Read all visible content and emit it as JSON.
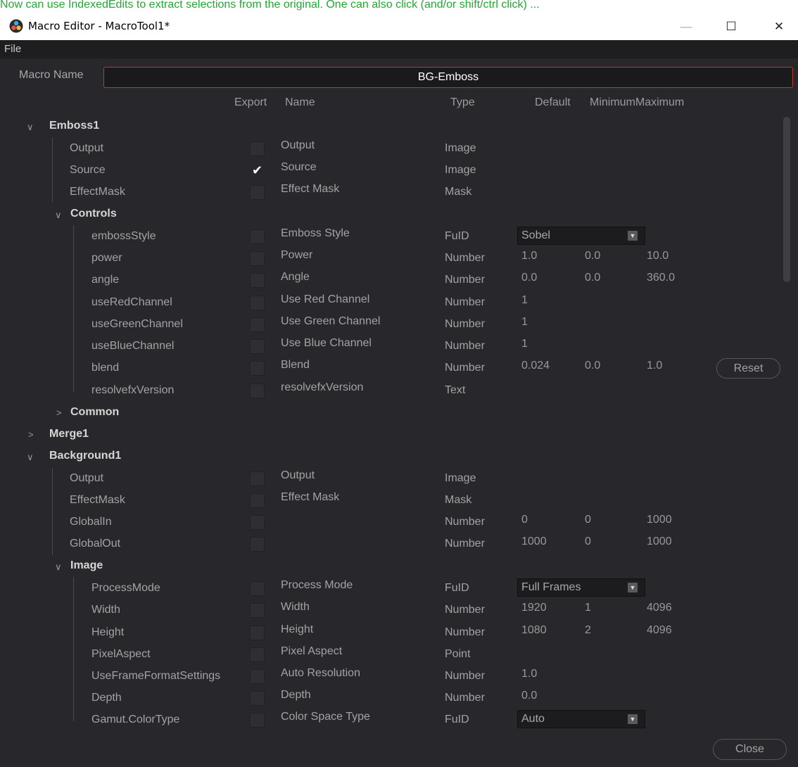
{
  "top_note": "Now can use IndexedEdits to extract selections from the original. One can also click (and/or shift/ctrl click) ...",
  "window": {
    "title": "Macro Editor - MacroTool1*",
    "minimize": "—",
    "maximize": "☐",
    "close": "✕"
  },
  "menu": {
    "file": "File"
  },
  "macro_name": {
    "label": "Macro Name",
    "value": "BG-Emboss"
  },
  "columns": {
    "export": "Export",
    "name": "Name",
    "type": "Type",
    "default": "Default",
    "minmax": "MinimumMaximum"
  },
  "groups": {
    "emboss1": "Emboss1",
    "controls": "Controls",
    "common": "Common",
    "merge1": "Merge1",
    "background1": "Background1",
    "image": "Image"
  },
  "emboss_io": [
    {
      "id": "Output",
      "name": "Output",
      "type": "Image",
      "checked": false
    },
    {
      "id": "Source",
      "name": "Source",
      "type": "Image",
      "checked": true
    },
    {
      "id": "EffectMask",
      "name": "Effect Mask",
      "type": "Mask",
      "checked": false
    }
  ],
  "controls": [
    {
      "id": "embossStyle",
      "name": "Emboss Style",
      "type": "FuID",
      "dropdown": "Sobel"
    },
    {
      "id": "power",
      "name": "Power",
      "type": "Number",
      "default": "1.0",
      "min": "0.0",
      "max": "10.0"
    },
    {
      "id": "angle",
      "name": "Angle",
      "type": "Number",
      "default": "0.0",
      "min": "0.0",
      "max": "360.0"
    },
    {
      "id": "useRedChannel",
      "name": "Use Red Channel",
      "type": "Number",
      "default": "1"
    },
    {
      "id": "useGreenChannel",
      "name": "Use Green Channel",
      "type": "Number",
      "default": "1"
    },
    {
      "id": "useBlueChannel",
      "name": "Use Blue Channel",
      "type": "Number",
      "default": "1"
    },
    {
      "id": "blend",
      "name": "Blend",
      "type": "Number",
      "default": "0.024",
      "min": "0.0",
      "max": "1.0"
    },
    {
      "id": "resolvefxVersion",
      "name": "resolvefxVersion",
      "type": "Text"
    }
  ],
  "reset_label": "Reset",
  "background_io": [
    {
      "id": "Output",
      "name": "Output",
      "type": "Image"
    },
    {
      "id": "EffectMask",
      "name": "Effect Mask",
      "type": "Mask"
    },
    {
      "id": "GlobalIn",
      "name": "",
      "type": "Number",
      "default": "0",
      "min": "0",
      "max": "1000"
    },
    {
      "id": "GlobalOut",
      "name": "",
      "type": "Number",
      "default": "1000",
      "min": "0",
      "max": "1000"
    }
  ],
  "image": [
    {
      "id": "ProcessMode",
      "name": "Process Mode",
      "type": "FuID",
      "dropdown": "Full Frames"
    },
    {
      "id": "Width",
      "name": "Width",
      "type": "Number",
      "default": "1920",
      "min": "1",
      "max": "4096"
    },
    {
      "id": "Height",
      "name": "Height",
      "type": "Number",
      "default": "1080",
      "min": "2",
      "max": "4096"
    },
    {
      "id": "PixelAspect",
      "name": "Pixel Aspect",
      "type": "Point"
    },
    {
      "id": "UseFrameFormatSettings",
      "name": "Auto Resolution",
      "type": "Number",
      "default": "1.0"
    },
    {
      "id": "Depth",
      "name": "Depth",
      "type": "Number",
      "default": "0.0"
    },
    {
      "id": "Gamut.ColorType",
      "name": "Color Space Type",
      "type": "FuID",
      "dropdown": "Auto"
    }
  ],
  "close_label": "Close",
  "icons": {
    "expanded": "chevron-down-icon",
    "collapsed": "chevron-right-icon",
    "dropdown": "triangle-down-icon",
    "check": "checkmark-icon"
  }
}
